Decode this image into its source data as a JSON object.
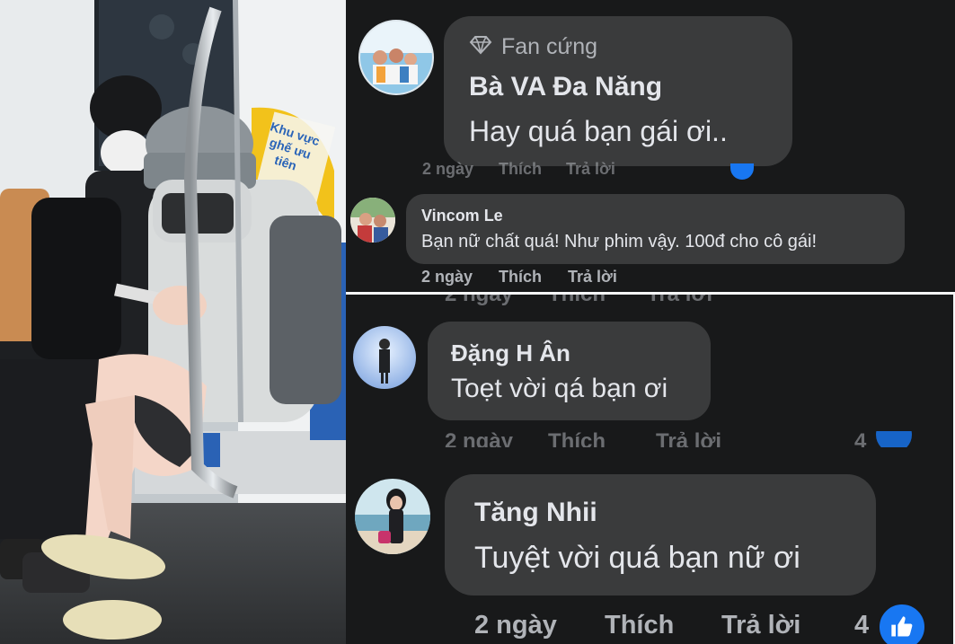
{
  "comments": [
    {
      "badge": "Fan cứng",
      "name": "Bà VA Đa Năng",
      "text": "Hay quá bạn gái ơi..",
      "time": "2 ngày",
      "like_label": "Thích",
      "reply_label": "Trả lời"
    },
    {
      "name": "Vincom Le",
      "text": "Bạn nữ chất quá! Như phim vậy. 100đ cho cô gái!",
      "time": "2 ngày",
      "like_label": "Thích",
      "reply_label": "Trả lời"
    },
    {
      "name": "Đặng H Ân",
      "text": "Toẹt vời qá bạn ơi",
      "time": "2 ngày",
      "like_label": "Thích",
      "reply_label": "Trả lời",
      "reaction_count": "4"
    },
    {
      "name": "Tăng Nhii",
      "text": "Tuyệt vời quá bạn nữ ơi",
      "time": "2 ngày",
      "like_label": "Thích",
      "reply_label": "Trả lời",
      "reaction_count": "4"
    }
  ],
  "photo": {
    "sign_text": "Khu vực ghế ưu tiên"
  },
  "colors": {
    "panel_bg": "#18191a",
    "bubble_bg": "#3a3b3c",
    "text_primary": "#e4e6eb",
    "text_secondary": "#b0b3b8",
    "like_blue": "#1877f2",
    "sign_yellow": "#f2c21b"
  },
  "icons": [
    "diamond-icon",
    "thumbs-up-icon"
  ]
}
